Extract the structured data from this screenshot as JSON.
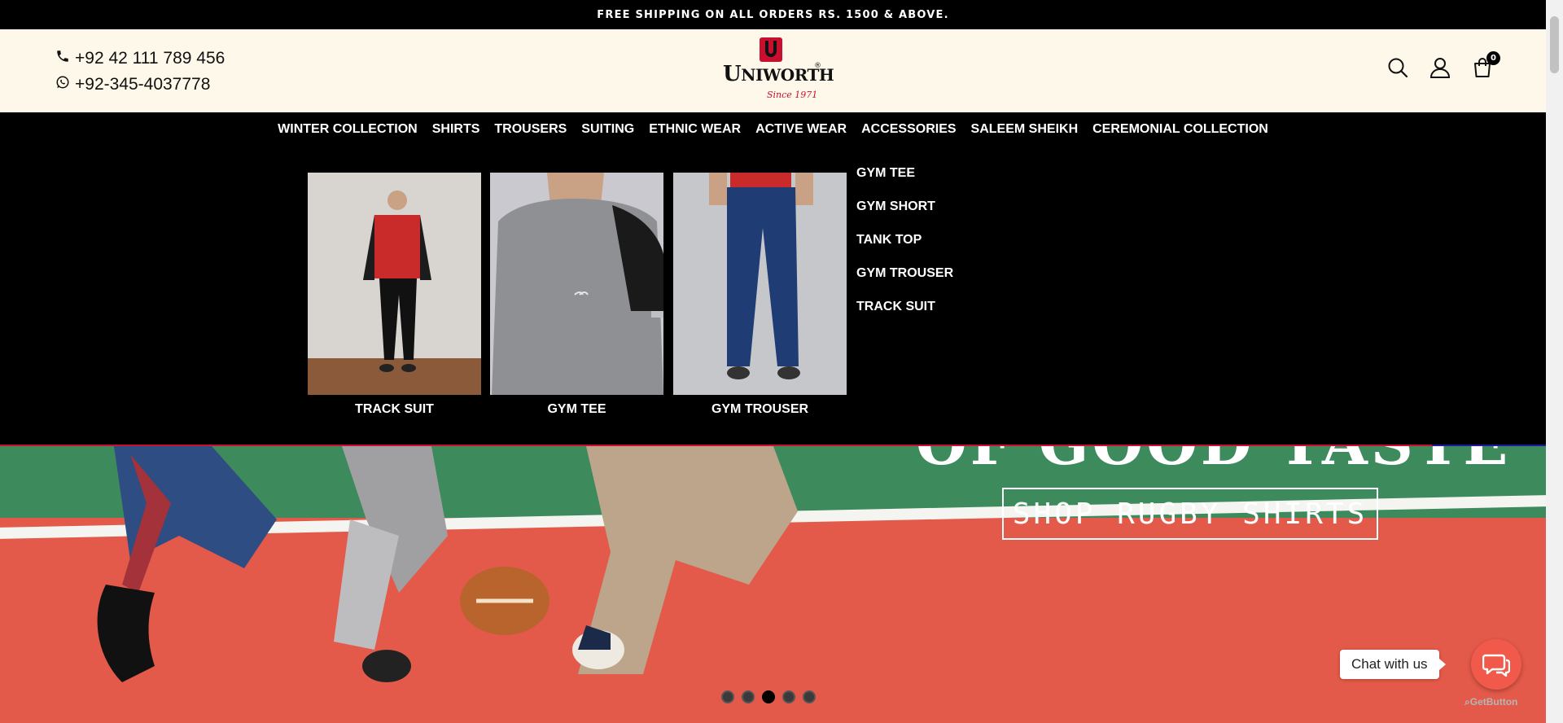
{
  "announcement": "FREE SHIPPING ON ALL ORDERS RS. 1500 & ABOVE.",
  "contact": {
    "phone": "+92 42 111 789 456",
    "whatsapp": "+92-345-4037778"
  },
  "logo": {
    "brand_first": "U",
    "brand_rest": "NIWORTH",
    "registered": "®",
    "since": "Since 1971"
  },
  "header_icons": [
    "search-icon",
    "user-icon",
    "cart-icon"
  ],
  "cart_count": "0",
  "nav": [
    {
      "label": "WINTER COLLECTION"
    },
    {
      "label": "SHIRTS"
    },
    {
      "label": "TROUSERS"
    },
    {
      "label": "SUITING"
    },
    {
      "label": "ETHNIC WEAR"
    },
    {
      "label": "ACTIVE WEAR"
    },
    {
      "label": "ACCESSORIES"
    },
    {
      "label": "SALEEM SHEIKH"
    },
    {
      "label": "CEREMONIAL COLLECTION"
    }
  ],
  "mega_menu": {
    "cards": [
      {
        "caption": "TRACK SUIT"
      },
      {
        "caption": "GYM TEE"
      },
      {
        "caption": "GYM TROUSER"
      }
    ],
    "links": [
      {
        "label": "GYM TEE"
      },
      {
        "label": "GYM SHORT"
      },
      {
        "label": "TANK TOP"
      },
      {
        "label": "GYM TROUSER"
      },
      {
        "label": "TRACK SUIT"
      }
    ]
  },
  "hero": {
    "headline": "OF GOOD TASTE",
    "cta": "SHOP RUGBY SHIRTS",
    "slide_count": 5,
    "active_slide": 3
  },
  "chat": {
    "label": "Chat with us",
    "provider": "GetButton"
  },
  "colors": {
    "black": "#000000",
    "header_bg": "#fdf8ea",
    "brand_red": "#c8102e",
    "chat_button": "#f15a4a",
    "court_red": "#e45a4a",
    "field_green": "#3d8a5c"
  }
}
